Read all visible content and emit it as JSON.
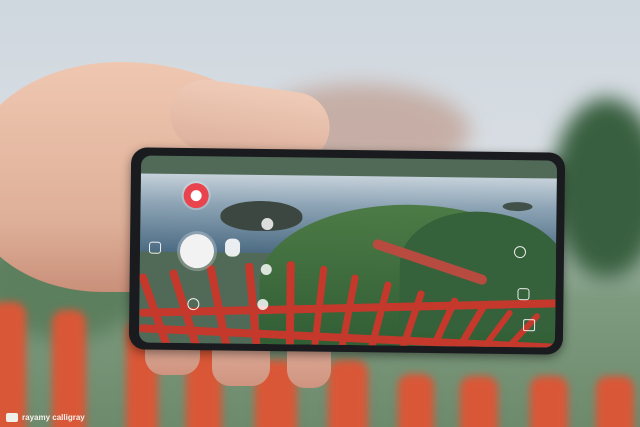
{
  "watermark": {
    "text": "rayamy calligray"
  }
}
